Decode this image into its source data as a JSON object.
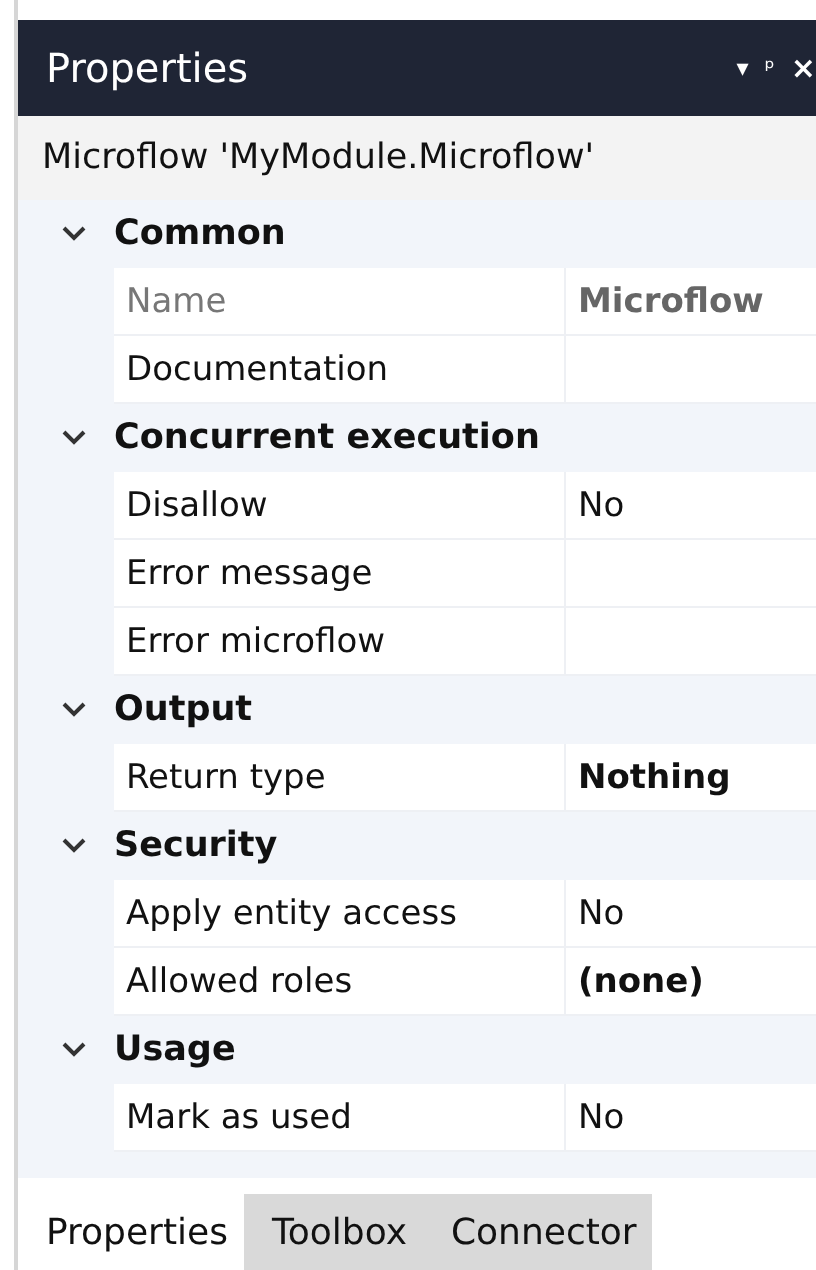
{
  "panel": {
    "title": "Properties",
    "controls": [
      "▾",
      "ᵖ",
      "×"
    ]
  },
  "subject": "Microflow 'MyModule.Microflow'",
  "groups": [
    {
      "title": "Common",
      "expanded": true,
      "rows": [
        {
          "label": "Name",
          "value": "Microflow",
          "bold": true,
          "disabled": true
        },
        {
          "label": "Documentation",
          "disabled": false
        }
      ]
    },
    {
      "title": "Concurrent execution",
      "expanded": true,
      "rows": [
        {
          "label": "Disallow",
          "value": "No",
          "bold": false,
          "disabled": false
        },
        {
          "label": "Error message",
          "disabled": false
        },
        {
          "label": "Error microflow",
          "disabled": false
        }
      ]
    },
    {
      "title": "Output",
      "expanded": true,
      "rows": [
        {
          "label": "Return type",
          "value": "Nothing",
          "bold": true,
          "disabled": false
        }
      ]
    },
    {
      "title": "Security",
      "expanded": true,
      "rows": [
        {
          "label": "Apply entity access",
          "value": "No",
          "bold": false,
          "disabled": false
        },
        {
          "label": "Allowed roles",
          "value": "(none)",
          "bold": true,
          "disabled": false
        }
      ]
    },
    {
      "title": "Usage",
      "expanded": true,
      "rows": [
        {
          "label": "Mark as used",
          "value": "No",
          "bold": false,
          "disabled": false
        }
      ]
    }
  ],
  "tabs": [
    {
      "label": "Properties",
      "selected": true
    },
    {
      "label": "Toolbox",
      "selected": false
    },
    {
      "label": "Connector",
      "selected": false
    }
  ]
}
